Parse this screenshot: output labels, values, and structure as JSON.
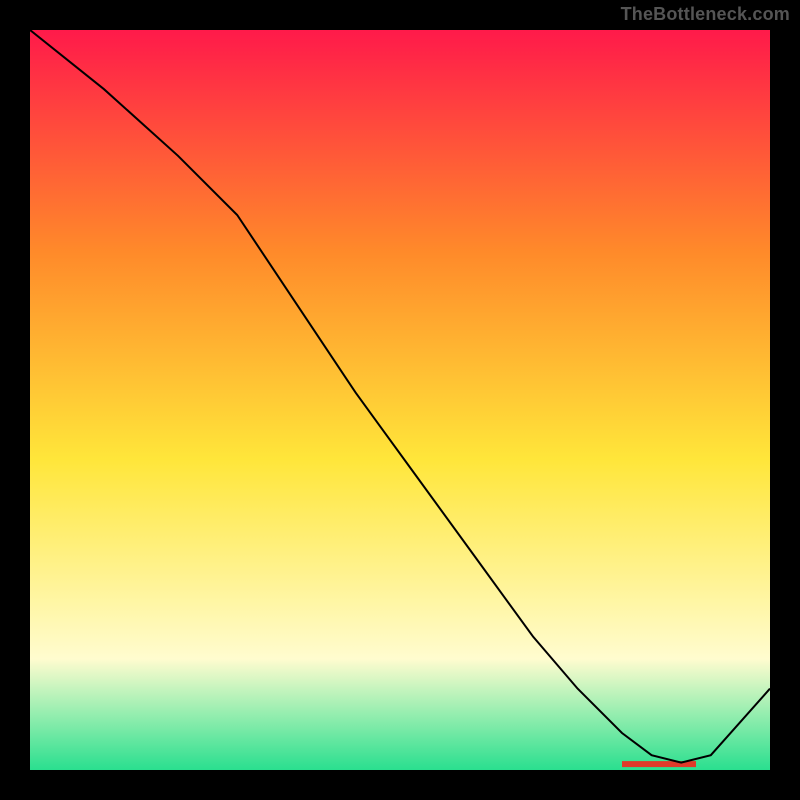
{
  "attribution": "TheBottleneck.com",
  "chart_data": {
    "type": "line",
    "title": "",
    "xlabel": "",
    "ylabel": "",
    "xlim": [
      0,
      100
    ],
    "ylim": [
      0,
      100
    ],
    "axes_visible": false,
    "grid": false,
    "background_gradient": {
      "top": "#ff1a4a",
      "mid_upper": "#ff8a2a",
      "mid": "#ffe63a",
      "lower": "#fffccf",
      "bottom": "#2adf8f"
    },
    "series": [
      {
        "name": "curve",
        "color": "#000000",
        "width": 2,
        "x": [
          0,
          10,
          20,
          28,
          36,
          44,
          52,
          60,
          68,
          74,
          80,
          84,
          88,
          92,
          100
        ],
        "y": [
          100,
          92,
          83,
          75,
          63,
          51,
          40,
          29,
          18,
          11,
          5,
          2,
          1,
          2,
          11
        ]
      }
    ],
    "annotations": [
      {
        "name": "min-marker",
        "type": "bar",
        "x_start": 80,
        "x_end": 90,
        "y": 0.8,
        "color": "#e03a2a"
      }
    ]
  }
}
